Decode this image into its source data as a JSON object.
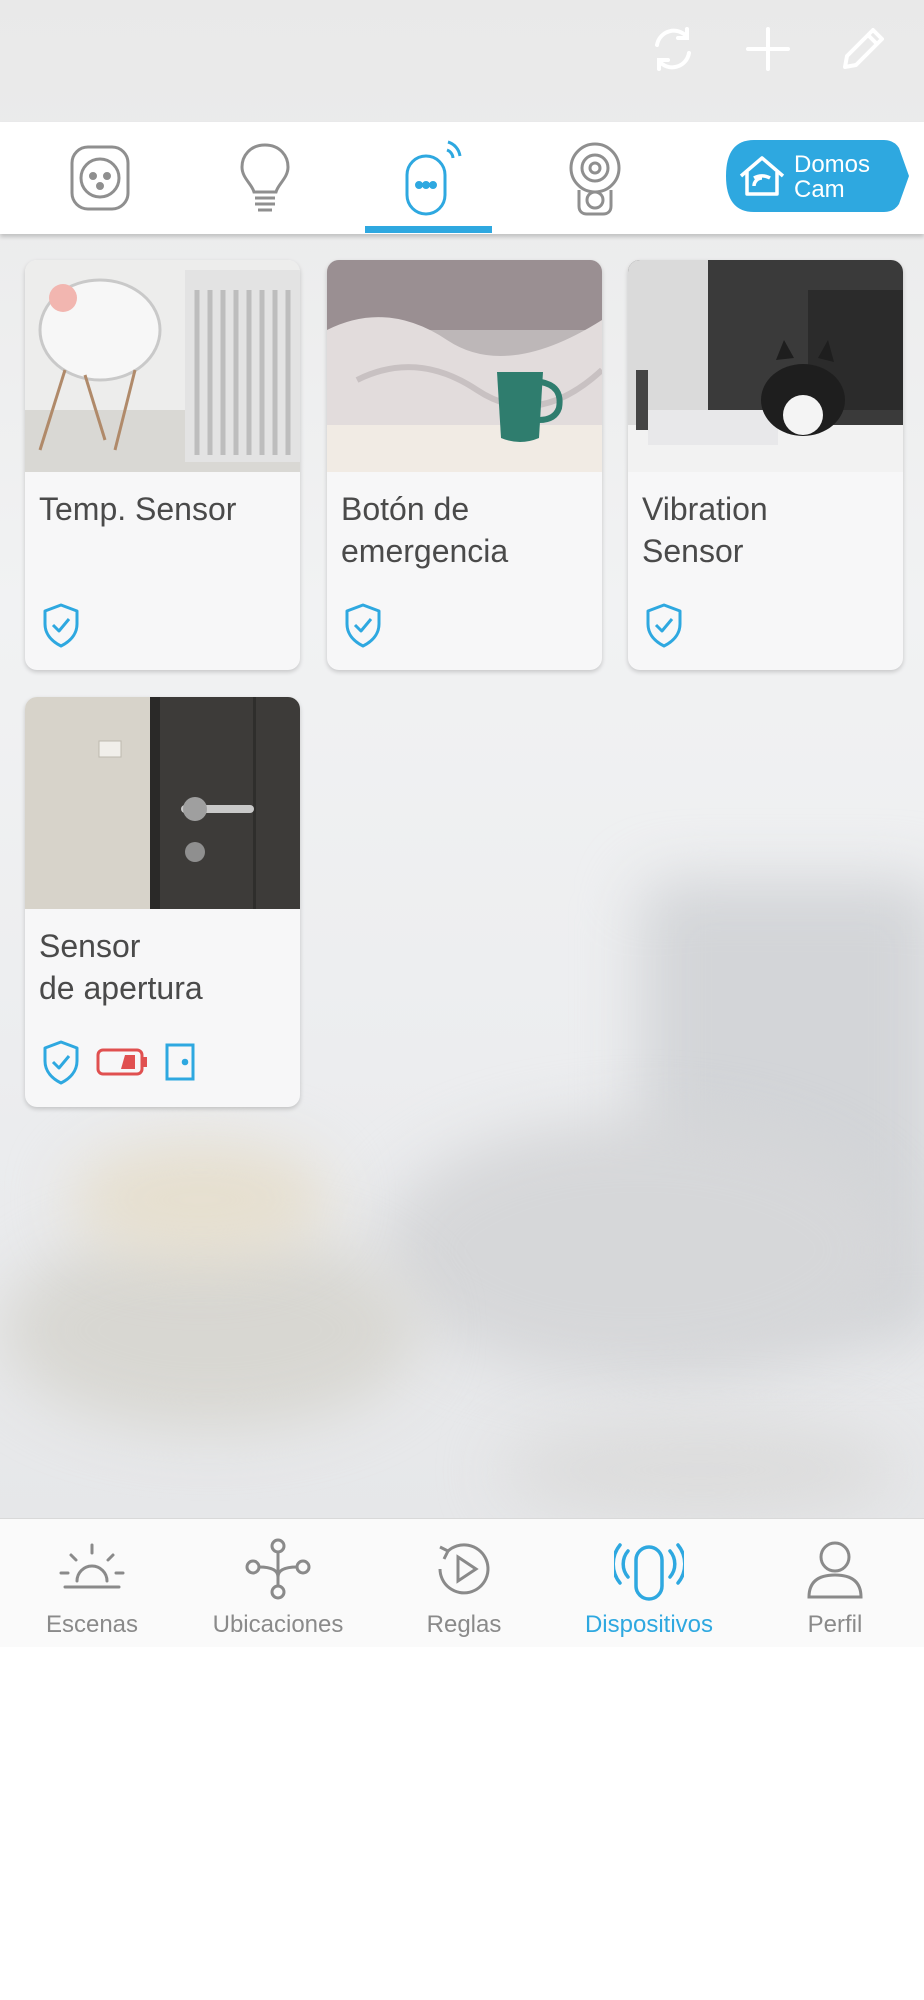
{
  "colors": {
    "accent": "#2ea8e0",
    "battery_low": "#e05050",
    "text": "#4a4a4a",
    "nav_inactive": "#8a8a8a"
  },
  "topbar": {
    "refresh_icon": "refresh-icon",
    "add_icon": "plus-icon",
    "edit_icon": "pencil-icon"
  },
  "categories": [
    {
      "icon": "smart-plug-icon"
    },
    {
      "icon": "light-bulb-icon"
    },
    {
      "icon": "sensor-icon",
      "active": true
    },
    {
      "icon": "camera-icon"
    }
  ],
  "domos": {
    "line1": "Domos",
    "line2": "Cam",
    "icon": "domoscam-house-icon"
  },
  "devices": [
    {
      "title": "Temp. Sensor",
      "status_icons": [
        "shield-check-icon"
      ]
    },
    {
      "title": "Botón de\nemergencia",
      "status_icons": [
        "shield-check-icon"
      ]
    },
    {
      "title": "Vibration\nSensor",
      "status_icons": [
        "shield-check-icon"
      ]
    },
    {
      "title": "Sensor\nde apertura",
      "status_icons": [
        "shield-check-icon",
        "battery-low-icon",
        "door-icon"
      ]
    }
  ],
  "nav": [
    {
      "label": "Escenas",
      "icon": "sunrise-icon"
    },
    {
      "label": "Ubicaciones",
      "icon": "network-icon"
    },
    {
      "label": "Reglas",
      "icon": "play-circle-icon"
    },
    {
      "label": "Dispositivos",
      "icon": "sensor-signal-icon",
      "active": true
    },
    {
      "label": "Perfil",
      "icon": "user-icon"
    }
  ]
}
